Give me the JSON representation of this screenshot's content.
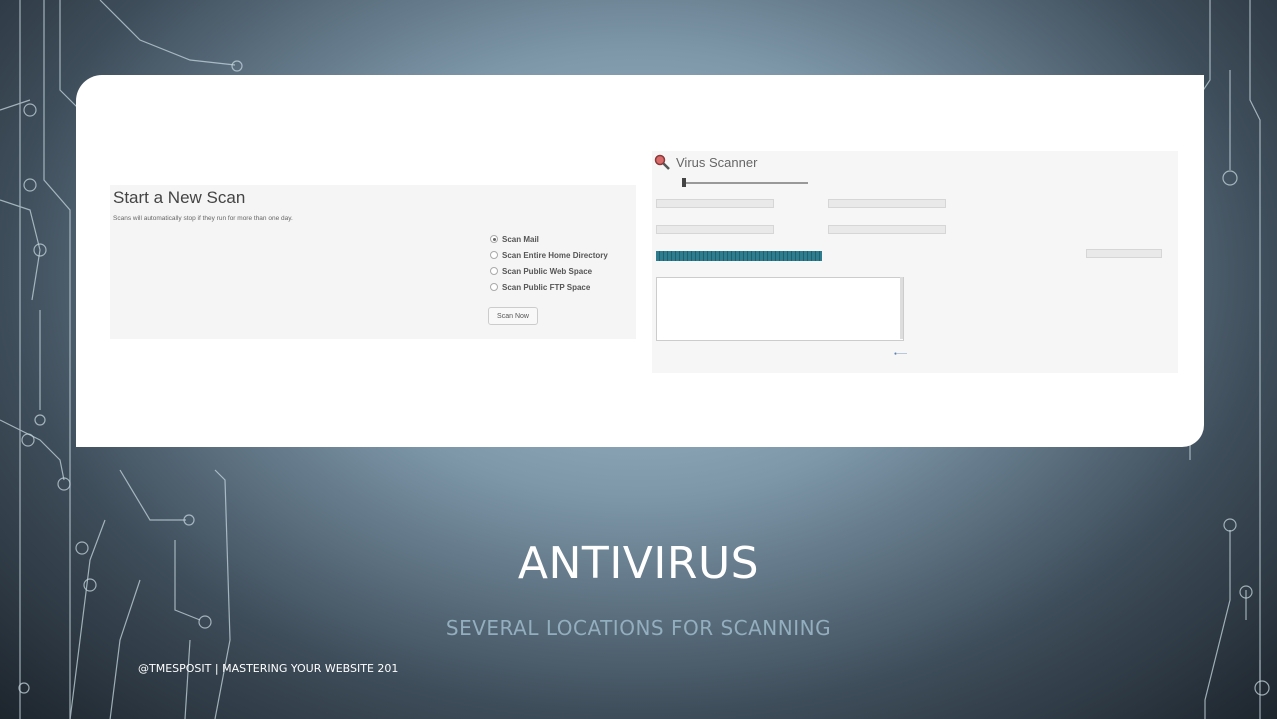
{
  "slide": {
    "title": "ANTIVIRUS",
    "subtitle": "SEVERAL LOCATIONS FOR SCANNING",
    "footer": "@TMESPOSIT | MASTERING YOUR WEBSITE 201"
  },
  "scan_panel": {
    "title": "Start a New Scan",
    "description": "Scans will automatically stop if they run for more than one day.",
    "options": [
      {
        "label": "Scan Mail",
        "checked": true
      },
      {
        "label": "Scan Entire Home Directory",
        "checked": false
      },
      {
        "label": "Scan Public Web Space",
        "checked": false
      },
      {
        "label": "Scan Public FTP Space",
        "checked": false
      }
    ],
    "scan_button": "Scan Now"
  },
  "virus_scanner": {
    "title": "Virus Scanner",
    "icon": "magnifier-icon"
  },
  "colors": {
    "progress": "#2e7d8e",
    "card_bg": "#ffffff",
    "title_text": "#ffffff",
    "subtitle_text": "#93aebe"
  }
}
